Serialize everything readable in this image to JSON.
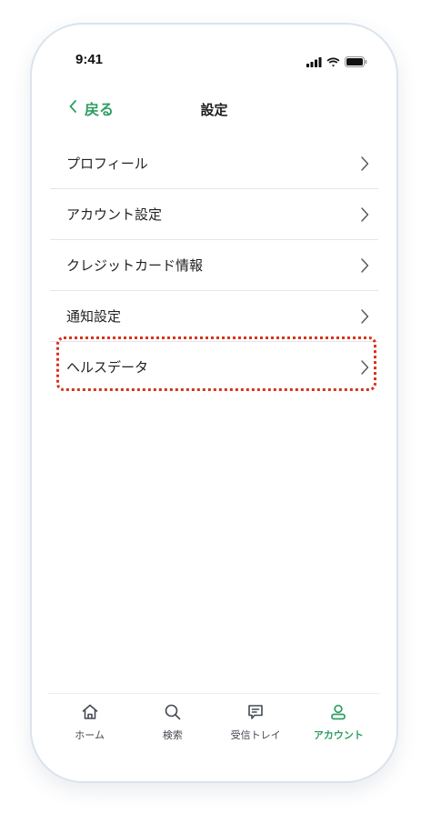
{
  "status_bar": {
    "time": "9:41",
    "icons": [
      "signal-icon",
      "wifi-icon",
      "battery-icon"
    ]
  },
  "header": {
    "back_label": "戻る",
    "title": "設定"
  },
  "settings": {
    "items": [
      {
        "label": "プロフィール"
      },
      {
        "label": "アカウント設定"
      },
      {
        "label": "クレジットカード情報"
      },
      {
        "label": "通知設定"
      },
      {
        "label": "ヘルスデータ",
        "highlighted": true
      }
    ]
  },
  "tab_bar": {
    "tabs": [
      {
        "label": "ホーム",
        "icon": "home-icon"
      },
      {
        "label": "検索",
        "icon": "search-icon"
      },
      {
        "label": "受信トレイ",
        "icon": "inbox-icon"
      },
      {
        "label": "アカウント",
        "icon": "user-icon",
        "active": true
      }
    ]
  },
  "colors": {
    "accent": "#2e9e63",
    "highlight_border": "#d6331c",
    "divider": "#e3e6ea"
  }
}
